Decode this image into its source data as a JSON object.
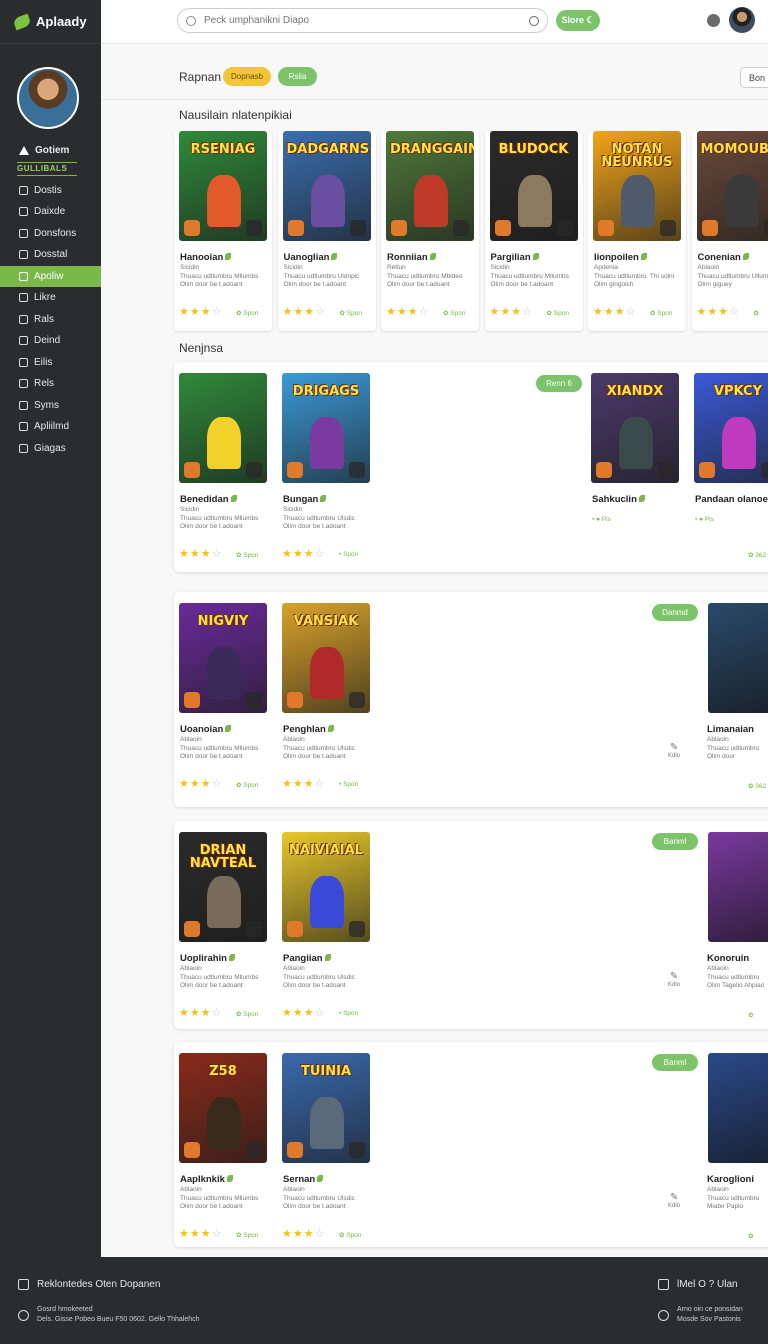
{
  "app": {
    "name": "Aplaady"
  },
  "colors": {
    "accent": "#7ab84a",
    "chip_yellow": "#f2c53b",
    "sidebar_bg": "#2b2c2d"
  },
  "sidebar": {
    "strip": "GULLIBALS",
    "items": [
      {
        "label": "Gotiem",
        "icon": "home-icon",
        "kind": "head"
      },
      {
        "label": "Dostis",
        "icon": "bag-icon"
      },
      {
        "label": "Daixde",
        "icon": "box-icon"
      },
      {
        "label": "Donsfons",
        "icon": "pen-icon"
      },
      {
        "label": "Dosstal",
        "icon": "doc-icon"
      },
      {
        "label": "Apoliw",
        "icon": "grid-icon",
        "active": true
      },
      {
        "label": "Likre",
        "icon": "chart-icon"
      },
      {
        "label": "Rals",
        "icon": "folder-icon"
      },
      {
        "label": "Deind",
        "icon": "file-icon"
      },
      {
        "label": "Eilis",
        "icon": "layers-icon"
      },
      {
        "label": "Rels",
        "icon": "tag-icon"
      },
      {
        "label": "Syms",
        "icon": "gear-icon"
      },
      {
        "label": "Apliilmd",
        "icon": "link-icon"
      },
      {
        "label": "Giagas",
        "icon": "globe-icon"
      }
    ]
  },
  "topbar": {
    "search_placeholder": "Pеck umphanikni Diapo",
    "button": "Slore ☾"
  },
  "filters": {
    "label": "Rapnan",
    "chip1": "Dopnasb",
    "chip2": "Rslia",
    "right": "Bon"
  },
  "section1": {
    "title": "Nausilain nlatenpikiai",
    "cards": [
      {
        "art": "RSENIAG",
        "title": "Hanooian",
        "sub": "Sicidin\nThuacu udtlumbru Mllumbs\nOlim door be t.adoant",
        "tag": "✿ Spon",
        "bg": "#2f8a3a",
        "fig": "#e25a2a"
      },
      {
        "art": "DADGARNS",
        "title": "Uanoglian",
        "sub": "Sicidin\nThuacu udtlumbru Uldnpic\nOlim door be t.adoant",
        "tag": "✿ Spon",
        "bg": "#3a6fb0",
        "fig": "#6a4fa0"
      },
      {
        "art": "DRANGGAIN",
        "title": "Ronniian",
        "sub": "Retlun\nThuacu udtlumbru Mbldeo\nOlim door be t.adoant",
        "tag": "✿ Spon",
        "bg": "#4f7a3a",
        "fig": "#c03a2a"
      },
      {
        "art": "BLUDOCK",
        "title": "Pargilian",
        "sub": "Sicidin\nThuacu udtlumbru Mllumbs\nOlim door be t.adoant",
        "tag": "✿ Spon",
        "bg": "#2a2a2a",
        "fig": "#8a7a60"
      },
      {
        "art": "NOTAN NEUNRUS",
        "title": "Iionpoilen",
        "sub": "Apdenia\nThuacu udtlumbru. Thi solni\nOlim gingolch",
        "tag": "✿ Spon",
        "bg": "#f2a41a",
        "fig": "#4f5a6a"
      },
      {
        "art": "MOMOUBOX",
        "title": "Conenian",
        "sub": "Ablaoin\nThuacu udtlumbru Ulluml\nOlim giguey",
        "tag": "✿",
        "bg": "#6a4a3a",
        "fig": "#3a3a3a"
      }
    ]
  },
  "section2": {
    "title": "Nenjnsa",
    "pill": "Renn 6",
    "cards": [
      {
        "art": "",
        "title": "Benedidan",
        "sub": "Sicidin\nThuacu udtlumbru Mllumbs\nOlim door be t.adoant",
        "tag": "✿ Spon",
        "bg": "#2f8a3a",
        "fig": "#f2d22a"
      },
      {
        "art": "DRIGAGS",
        "title": "Bungan",
        "sub": "Sicidin\nThuacu udtlumbru Ulsdic\nOlim door be t.adoant",
        "tag": "• Spon",
        "bg": "#3a9ad8",
        "fig": "#7a3aa0"
      }
    ],
    "right_cards": [
      {
        "art": "XIANDX",
        "title": "Sahkuclin",
        "tag": "• ● Pis",
        "bg": "#4a3a6a",
        "fig": "#3a4a4a"
      },
      {
        "art": "VPKCY",
        "title": "Pandaan olanoes",
        "tag": "• ● Pis",
        "bg": "#3a5ad8",
        "fig": "#c03ac0"
      }
    ],
    "right_tag": "✿ 362"
  },
  "section3": {
    "pill": "Danmd",
    "cards": [
      {
        "art": "NIGVIY",
        "title": "Uoanoian",
        "sub": "Ablaoin\nThuacu udtlumbru Mllumbs\nOlim door be t.adoant",
        "tag": "✿ Spon",
        "bg": "#6a2a9a",
        "fig": "#3a2a5a"
      },
      {
        "art": "VANSIAK",
        "title": "Penghlan",
        "sub": "Ablaoin\nThuacu udtlumbru Ulsdic\nOlim door be t.adoant",
        "tag": "• Spon",
        "bg": "#d8a22a",
        "fig": "#b02a2a"
      }
    ],
    "edit_label": "Kdlo",
    "right_title": "Limanaian",
    "right_sub": "Ablaoin\nThuacu udtlumbru\nOlim door",
    "right_tag": "✿ 362",
    "right_bg": "#2a4a6a"
  },
  "section4": {
    "pill": "Banml",
    "cards": [
      {
        "art": "DRIAN NAVTEAL",
        "title": "Uoplirahin",
        "sub": "Ablaoin\nThuacu udtlumbru Mllumbs\nOlim door be t.adoant",
        "tag": "✿ Spon",
        "bg": "#2a2a2a",
        "fig": "#7a6a5a"
      },
      {
        "art": "NAIVIAIAL",
        "title": "Pangiian",
        "sub": "Ablaoin\nThuacu udtlumbru Ulsdic\nOlim door be t.adoant",
        "tag": "• Spon",
        "bg": "#e8c82a",
        "fig": "#3a4ad8"
      }
    ],
    "edit_label": "Kdlo",
    "right_title": "Konoruin",
    "right_sub": "Ablaoin\nThuacu udtlumbru\nOlim Tagelio Ahpiao",
    "right_tag": "✿",
    "right_bg": "#7a3aa0"
  },
  "section5": {
    "pill": "Banml",
    "cards": [
      {
        "art": "Z58",
        "title": "Aaplknkik",
        "sub": "Ablaoin\nThuacu udtlumbru Mllumbs\nOlim door be t.adoant",
        "tag": "✿ Spon",
        "bg": "#8a2a1a",
        "fig": "#3a2a1a"
      },
      {
        "art": "TUINIA",
        "title": "Sernan",
        "sub": "Ablaoin\nThuacu udtlumbru Ulsdic\nOlim door be t.adoant",
        "tag": "✿ Spon",
        "bg": "#3a6ab0",
        "fig": "#5a6a7a"
      }
    ],
    "edit_label": "Kdlo",
    "right_title": "Karoglioni",
    "right_sub": "Ablaoin\nThuacu udtlumbru\nMiabir Paplo",
    "right_tag": "✿",
    "right_bg": "#2a4a8a"
  },
  "footer": {
    "left_title": "Reklontedes Oten Dopanen",
    "left_line1": "Gosrd hmokeeted",
    "left_line2": "Dels. Gisse Pobeo Bueu F50 0602. Gello Thhalehch",
    "right_title": "lMel O ? Ulan",
    "right_line1": "Arno oin ce ponsidan",
    "right_line2": "Mosde Sov Pastonis"
  }
}
